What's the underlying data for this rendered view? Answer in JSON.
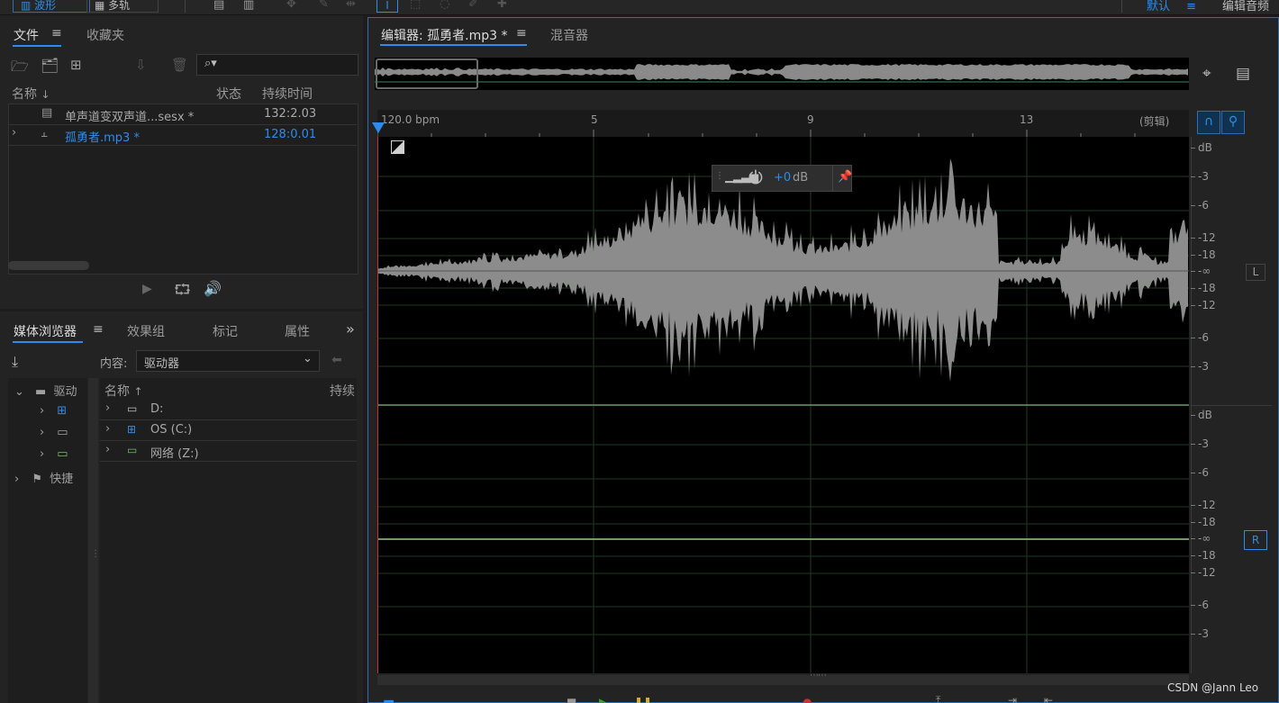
{
  "topbar": {
    "waveform_label": "波形",
    "multitrack_label": "多轨",
    "workspace_label": "默认",
    "editor_audio_label": "编辑音频"
  },
  "files_panel": {
    "tabs": [
      "文件",
      "收藏夹"
    ],
    "columns": {
      "name": "名称",
      "status": "状态",
      "duration": "持续时间"
    },
    "rows": [
      {
        "name": "单声道变双声道...sesx *",
        "duration": "132:2.03"
      },
      {
        "name": "孤勇者.mp3 *",
        "duration": "128:0.01"
      }
    ]
  },
  "media_panel": {
    "tabs": [
      "媒体浏览器",
      "效果组",
      "标记",
      "属性"
    ],
    "content_label": "内容:",
    "content_value": "驱动器",
    "tree": [
      "驱动",
      "快捷"
    ],
    "columns": {
      "name": "名称",
      "duration": "持续"
    },
    "drives": [
      "D:",
      "OS (C:)",
      "网络 (Z:)"
    ]
  },
  "editor": {
    "tab_label": "编辑器: 孤勇者.mp3 *",
    "mixer_label": "混音器",
    "bpm_label": "120.0 bpm",
    "ruler_marks": [
      "5",
      "9",
      "13"
    ],
    "clip_label": "(剪辑)",
    "hud_gain": "+0",
    "hud_unit": "dB",
    "channel_left": "L",
    "channel_right": "R",
    "db_top": [
      "dB",
      "-3",
      "-6",
      "-12",
      "-18",
      "-∞",
      "-18",
      "-12",
      "-6",
      "-3"
    ],
    "db_bottom": [
      "dB",
      "-3",
      "-6",
      "-12",
      "-18",
      "-∞",
      "-18",
      "-12",
      "-6",
      "-3"
    ]
  },
  "watermark": "CSDN @Jann Leo"
}
